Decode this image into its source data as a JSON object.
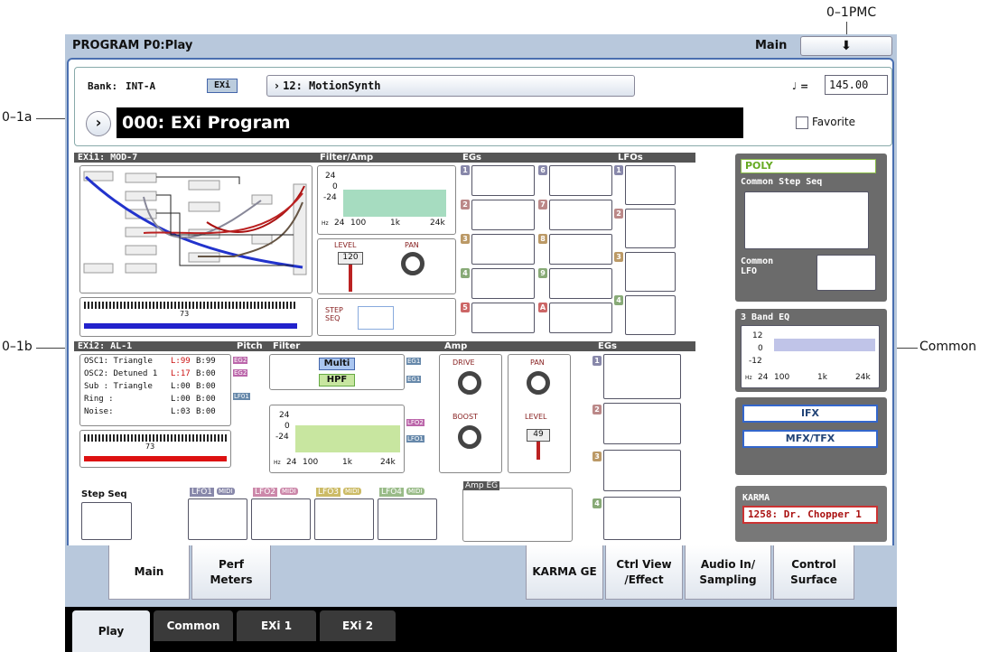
{
  "callouts": {
    "pmc": "0–1PMC",
    "a": "0–1a",
    "b": "0–1b",
    "common": "Common"
  },
  "title": "PROGRAM P0:Play",
  "page_menu": "Main",
  "header": {
    "bank_label": "Bank:",
    "bank_value": "INT-A",
    "exi_badge": "EXi",
    "combi_name": "12: MotionSynth",
    "tempo_symbol": "♩ =",
    "tempo_value": "145.00",
    "program_name": "000: EXi Program",
    "favorite_label": "Favorite"
  },
  "exi1": {
    "title": "EXi1:  MOD-7",
    "filter_amp": "Filter/Amp",
    "egs": "EGs",
    "lfos": "LFOs",
    "level_label": "LEVEL",
    "level_value": "120",
    "pan_label": "PAN",
    "step_seq": "STEP\nSEQ",
    "keyboard_value": "73",
    "filter_y": [
      "24",
      "0",
      "-24"
    ],
    "filter_x": [
      "Hz",
      "24",
      "100",
      "1k",
      "24k"
    ],
    "eg_nums": [
      "1",
      "2",
      "3",
      "4",
      "5",
      "6",
      "7",
      "8",
      "9",
      "A"
    ],
    "lfo_nums": [
      "1",
      "2",
      "3",
      "4"
    ]
  },
  "exi2": {
    "title": "EXi2:  AL-1",
    "pitch": "Pitch",
    "filter": "Filter",
    "amp": "Amp",
    "egs": "EGs",
    "osc": [
      {
        "name": "OSC1: Triangle",
        "l": "L:99",
        "b": "B:99",
        "eg": "EG2"
      },
      {
        "name": "OSC2: Detuned 1",
        "l": "L:17",
        "b": "B:00",
        "eg": "EG2"
      },
      {
        "name": "Sub  : Triangle",
        "l": "L:00",
        "b": "B:00",
        "eg": ""
      },
      {
        "name": "Ring  :",
        "l": "L:00",
        "b": "B:00",
        "eg": "LF01"
      },
      {
        "name": "Noise:",
        "l": "L:03",
        "b": "B:00",
        "eg": ""
      }
    ],
    "multi": "Multi",
    "hpf": "HPF",
    "eg1a": "EG1",
    "eg1b": "EG1",
    "lfo2": "LFO2",
    "lfo1": "LFO1",
    "drive": "DRIVE",
    "boost": "BOOST",
    "pan": "PAN",
    "level": "LEVEL",
    "level_value": "49",
    "amp_eg": "Amp EG",
    "keyboard_value": "73",
    "step_seq": "Step Seq",
    "lfos": [
      {
        "label": "LFO1",
        "midi": "MIDI"
      },
      {
        "label": "LFO2",
        "midi": "MIDI"
      },
      {
        "label": "LFO3",
        "midi": "MIDI"
      },
      {
        "label": "LFO4",
        "midi": "MIDI"
      }
    ],
    "filter_y": [
      "24",
      "0",
      "-24"
    ],
    "filter_x": [
      "Hz",
      "24",
      "100",
      "1k",
      "24k"
    ],
    "eg_nums": [
      "1",
      "2",
      "3",
      "4"
    ]
  },
  "common": {
    "poly": "POLY",
    "step_seq": "Common Step Seq",
    "lfo": "Common\nLFO",
    "eq_title": "3 Band EQ",
    "eq_y": [
      "12",
      "0",
      "-12"
    ],
    "eq_x": [
      "Hz",
      "24",
      "100",
      "1k",
      "24k"
    ],
    "ifx": "IFX",
    "mfx": "MFX/TFX",
    "karma": "KARMA",
    "karma_value": "1258: Dr. Chopper 1"
  },
  "tabs": [
    "Main",
    "Perf\nMeters",
    "KARMA GE",
    "Ctrl View\n/Effect",
    "Audio In/\nSampling",
    "Control\nSurface"
  ],
  "bottom_tabs": [
    "Play",
    "Common",
    "EXi 1",
    "EXi 2"
  ]
}
